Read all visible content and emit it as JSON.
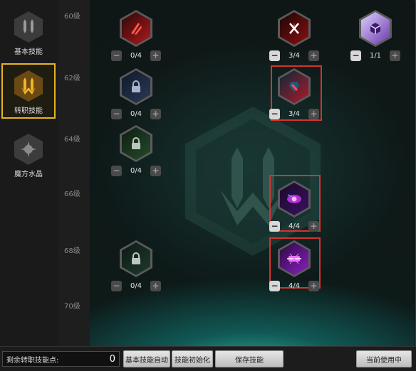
{
  "tabs": [
    {
      "label": "基本技能"
    },
    {
      "label": "转职技能"
    },
    {
      "label": "魔方水晶"
    }
  ],
  "levels": [
    "60级",
    "62级",
    "64级",
    "66级",
    "68级",
    "70级"
  ],
  "skills": [
    {
      "icon": "red-claw-skill-icon",
      "count": "0/4"
    },
    {
      "icon": "red-cross-slash-skill-icon",
      "count": "3/4"
    },
    {
      "icon": "purple-cube-skill-icon",
      "count": "1/1"
    },
    {
      "icon": "lock-icon",
      "count": "0/4"
    },
    {
      "icon": "crimson-blade-skill-icon",
      "count": "3/4"
    },
    {
      "icon": "lock-icon",
      "count": "0/4"
    },
    {
      "icon": "violet-eye-skill-icon",
      "count": "4/4"
    },
    {
      "icon": "lock-icon",
      "count": "0/4"
    },
    {
      "icon": "purple-burst-skill-icon",
      "count": "4/4"
    }
  ],
  "bottom": {
    "points_label": "剩余转职技能点:",
    "points_value": "0",
    "auto_label": "基本技能自动",
    "reset_label": "技能初始化",
    "save_label": "保存技能",
    "current_label": "当前使用中"
  },
  "colors": {
    "active_tab_border": "#e6b422",
    "highlight_border": "#d7322c",
    "glow": "#3ce6d2"
  }
}
